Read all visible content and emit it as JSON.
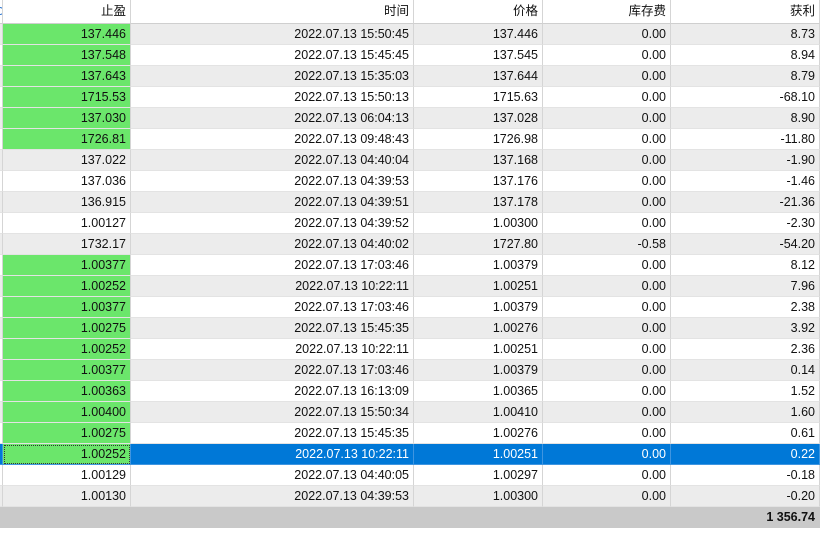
{
  "colors": {
    "tp_highlight": "#6be66b",
    "selection": "#0078d7",
    "row_alt": "#ececec",
    "total_bar": "#c9c9c9"
  },
  "table": {
    "columns": {
      "take_profit": "止盈",
      "time": "时间",
      "price": "价格",
      "swap": "库存费",
      "profit": "获利"
    },
    "rows": [
      {
        "take_profit": "137.446",
        "time": "2022.07.13 15:50:45",
        "price": "137.446",
        "swap": "0.00",
        "profit": "8.73",
        "tp_highlight": true
      },
      {
        "take_profit": "137.548",
        "time": "2022.07.13 15:45:45",
        "price": "137.545",
        "swap": "0.00",
        "profit": "8.94",
        "tp_highlight": true
      },
      {
        "take_profit": "137.643",
        "time": "2022.07.13 15:35:03",
        "price": "137.644",
        "swap": "0.00",
        "profit": "8.79",
        "tp_highlight": true
      },
      {
        "take_profit": "1715.53",
        "time": "2022.07.13 15:50:13",
        "price": "1715.63",
        "swap": "0.00",
        "profit": "-68.10",
        "tp_highlight": true
      },
      {
        "take_profit": "137.030",
        "time": "2022.07.13 06:04:13",
        "price": "137.028",
        "swap": "0.00",
        "profit": "8.90",
        "tp_highlight": true
      },
      {
        "take_profit": "1726.81",
        "time": "2022.07.13 09:48:43",
        "price": "1726.98",
        "swap": "0.00",
        "profit": "-11.80",
        "tp_highlight": true
      },
      {
        "take_profit": "137.022",
        "time": "2022.07.13 04:40:04",
        "price": "137.168",
        "swap": "0.00",
        "profit": "-1.90",
        "tp_highlight": false
      },
      {
        "take_profit": "137.036",
        "time": "2022.07.13 04:39:53",
        "price": "137.176",
        "swap": "0.00",
        "profit": "-1.46",
        "tp_highlight": false
      },
      {
        "take_profit": "136.915",
        "time": "2022.07.13 04:39:51",
        "price": "137.178",
        "swap": "0.00",
        "profit": "-21.36",
        "tp_highlight": false
      },
      {
        "take_profit": "1.00127",
        "time": "2022.07.13 04:39:52",
        "price": "1.00300",
        "swap": "0.00",
        "profit": "-2.30",
        "tp_highlight": false
      },
      {
        "take_profit": "1732.17",
        "time": "2022.07.13 04:40:02",
        "price": "1727.80",
        "swap": "-0.58",
        "profit": "-54.20",
        "tp_highlight": false
      },
      {
        "take_profit": "1.00377",
        "time": "2022.07.13 17:03:46",
        "price": "1.00379",
        "swap": "0.00",
        "profit": "8.12",
        "tp_highlight": true
      },
      {
        "take_profit": "1.00252",
        "time": "2022.07.13 10:22:11",
        "price": "1.00251",
        "swap": "0.00",
        "profit": "7.96",
        "tp_highlight": true
      },
      {
        "take_profit": "1.00377",
        "time": "2022.07.13 17:03:46",
        "price": "1.00379",
        "swap": "0.00",
        "profit": "2.38",
        "tp_highlight": true
      },
      {
        "take_profit": "1.00275",
        "time": "2022.07.13 15:45:35",
        "price": "1.00276",
        "swap": "0.00",
        "profit": "3.92",
        "tp_highlight": true
      },
      {
        "take_profit": "1.00252",
        "time": "2022.07.13 10:22:11",
        "price": "1.00251",
        "swap": "0.00",
        "profit": "2.36",
        "tp_highlight": true
      },
      {
        "take_profit": "1.00377",
        "time": "2022.07.13 17:03:46",
        "price": "1.00379",
        "swap": "0.00",
        "profit": "0.14",
        "tp_highlight": true
      },
      {
        "take_profit": "1.00363",
        "time": "2022.07.13 16:13:09",
        "price": "1.00365",
        "swap": "0.00",
        "profit": "1.52",
        "tp_highlight": true
      },
      {
        "take_profit": "1.00400",
        "time": "2022.07.13 15:50:34",
        "price": "1.00410",
        "swap": "0.00",
        "profit": "1.60",
        "tp_highlight": true
      },
      {
        "take_profit": "1.00275",
        "time": "2022.07.13 15:45:35",
        "price": "1.00276",
        "swap": "0.00",
        "profit": "0.61",
        "tp_highlight": true
      },
      {
        "take_profit": "1.00252",
        "time": "2022.07.13 10:22:11",
        "price": "1.00251",
        "swap": "0.00",
        "profit": "0.22",
        "tp_highlight": true,
        "selected": true
      },
      {
        "take_profit": "1.00129",
        "time": "2022.07.13 04:40:05",
        "price": "1.00297",
        "swap": "0.00",
        "profit": "-0.18",
        "tp_highlight": false
      },
      {
        "take_profit": "1.00130",
        "time": "2022.07.13 04:39:53",
        "price": "1.00300",
        "swap": "0.00",
        "profit": "-0.20",
        "tp_highlight": false
      }
    ],
    "total_profit": "1 356.74"
  }
}
